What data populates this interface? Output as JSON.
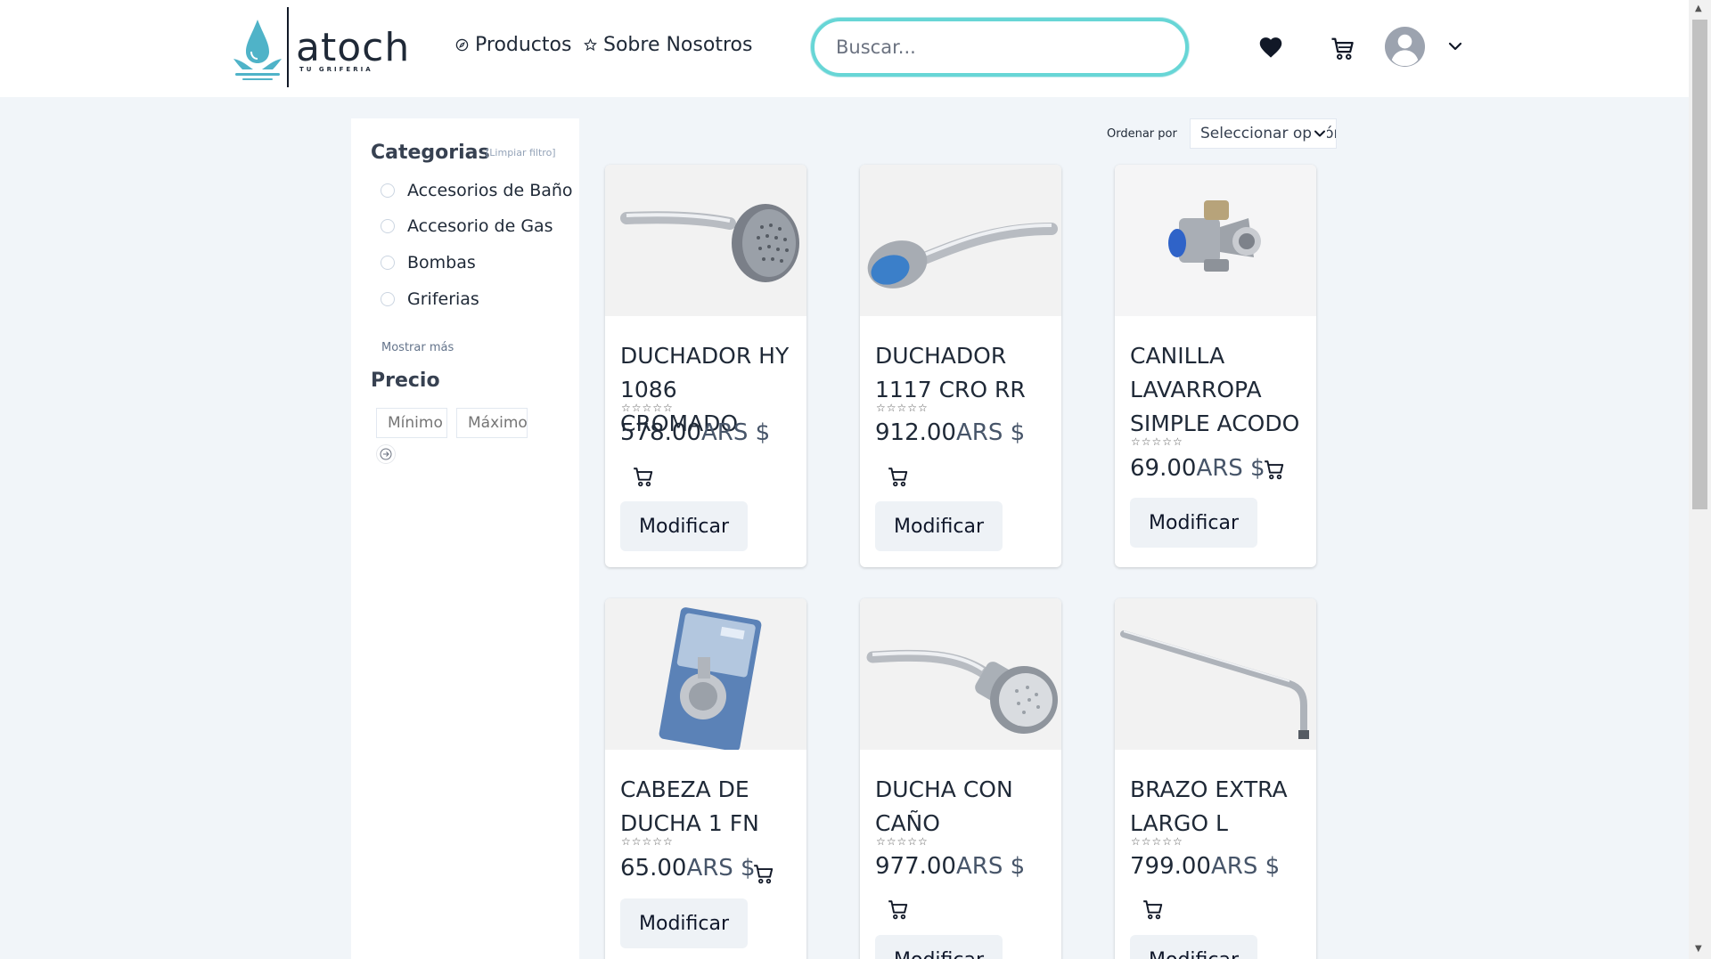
{
  "header": {
    "logo_word": "atoch",
    "logo_tagline": "TU GRIFERIA",
    "nav": [
      {
        "label": "Productos",
        "icon": "compass-icon"
      },
      {
        "label": "Sobre Nosotros",
        "icon": "star-icon"
      }
    ],
    "search_placeholder": "Buscar...",
    "icons": [
      "heart-icon",
      "cart-icon",
      "avatar-icon",
      "chevron-down-icon"
    ]
  },
  "sidebar": {
    "categories_title": "Categorias",
    "clear_filter": "[Limpiar filtro]",
    "categories": [
      "Accesorios de Baño",
      "Accesorio de Gas",
      "Bombas",
      "Griferias"
    ],
    "show_more": "Mostrar más",
    "price_title": "Precio",
    "min_placeholder": "Mínimo",
    "max_placeholder": "Máximo"
  },
  "sort": {
    "label": "Ordenar por",
    "selected": "Seleccionar opción"
  },
  "products": [
    {
      "title": "DUCHADOR HY 1086 CROMADO",
      "price": "578.00",
      "currency": "ARS $",
      "button": "Modificar",
      "rating": 0
    },
    {
      "title": "DUCHADOR 1117 CRO RR",
      "price": "912.00",
      "currency": "ARS $",
      "button": "Modificar",
      "rating": 0
    },
    {
      "title": "CANILLA LAVARROPA SIMPLE ACODO",
      "price": "69.00",
      "currency": "ARS $",
      "button": "Modificar",
      "rating": 0
    },
    {
      "title": "CABEZA DE DUCHA 1 FN",
      "price": "65.00",
      "currency": "ARS $",
      "button": "Modificar",
      "rating": 0
    },
    {
      "title": "DUCHA CON CAÑO",
      "price": "977.00",
      "currency": "ARS $",
      "button": "Modificar",
      "rating": 0
    },
    {
      "title": "BRAZO EXTRA LARGO L",
      "price": "799.00",
      "currency": "ARS $",
      "button": "Modificar",
      "rating": 0
    }
  ],
  "colors": {
    "accent": "#67d6d6",
    "logo_blue": "#4fb3c8",
    "background": "#f1f5f9"
  }
}
